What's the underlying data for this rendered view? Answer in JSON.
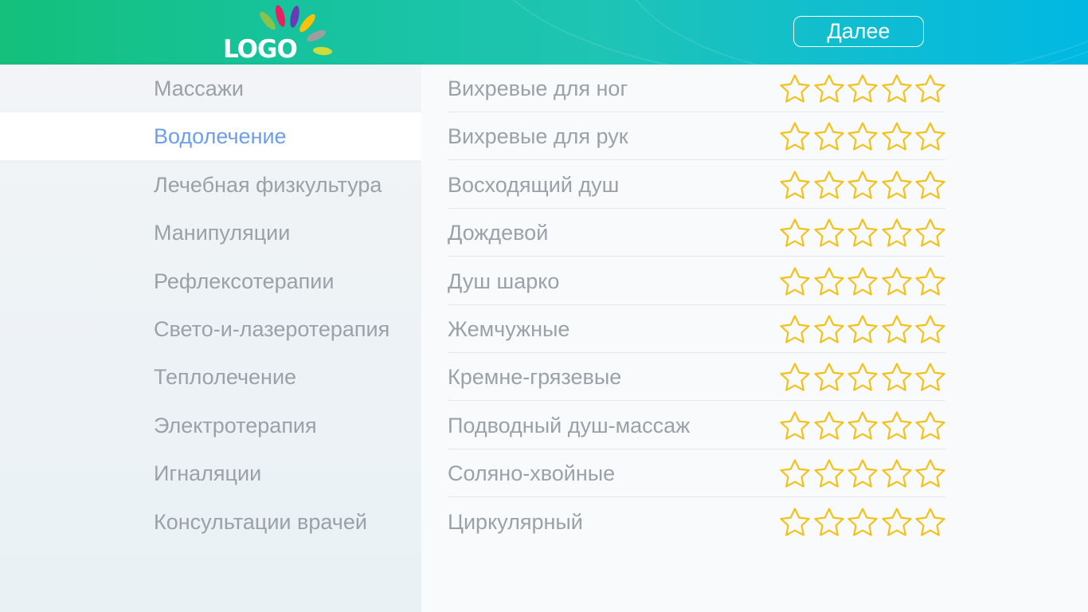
{
  "header": {
    "logo_text": "LOGO",
    "next_label": "Далее"
  },
  "colors": {
    "accent_active": "#6f9ee9",
    "text_muted": "#9aa1a7",
    "star": "#f2c21b"
  },
  "icons": {
    "logo": "petal-flower-icon",
    "rating": "star-outline-icon"
  },
  "sidebar": {
    "active_index": 1,
    "items": [
      {
        "label": "Массажи"
      },
      {
        "label": "Водолечение"
      },
      {
        "label": "Лечебная физкультура"
      },
      {
        "label": "Манипуляции"
      },
      {
        "label": "Рефлексотерапии"
      },
      {
        "label": "Свето-и-лазеротерапия"
      },
      {
        "label": "Теплолечение"
      },
      {
        "label": "Электротерапия"
      },
      {
        "label": "Игналяции"
      },
      {
        "label": "Консультации врачей"
      }
    ]
  },
  "procedures": {
    "max_stars": 5,
    "items": [
      {
        "label": "Вихревые для ног",
        "rating": 0
      },
      {
        "label": "Вихревые для рук",
        "rating": 0
      },
      {
        "label": "Восходящий душ",
        "rating": 0
      },
      {
        "label": "Дождевой",
        "rating": 0
      },
      {
        "label": "Душ шарко",
        "rating": 0
      },
      {
        "label": "Жемчужные",
        "rating": 0
      },
      {
        "label": "Кремне-грязевые",
        "rating": 0
      },
      {
        "label": "Подводный душ-массаж",
        "rating": 0
      },
      {
        "label": "Соляно-хвойные",
        "rating": 0
      },
      {
        "label": "Циркулярный",
        "rating": 0
      }
    ]
  }
}
